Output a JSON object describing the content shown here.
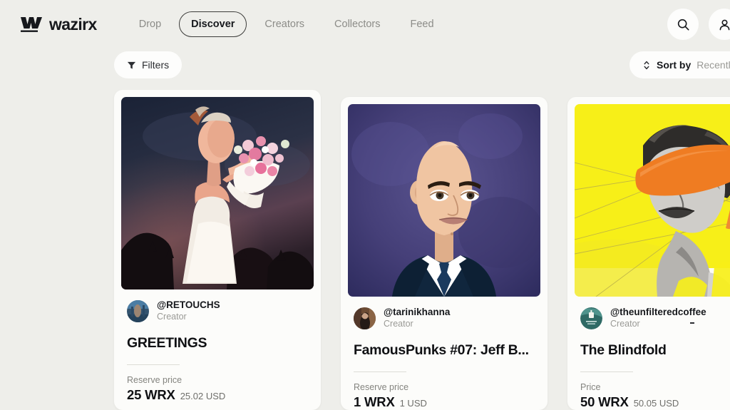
{
  "header": {
    "brand": "wazirx",
    "brand_icon": "wazirx-logo-mark",
    "nav": [
      {
        "label": "Drop",
        "active": false
      },
      {
        "label": "Discover",
        "active": true
      },
      {
        "label": "Creators",
        "active": false
      },
      {
        "label": "Collectors",
        "active": false
      },
      {
        "label": "Feed",
        "active": false
      }
    ],
    "search_icon": "search-icon",
    "secondary_icon": "account-icon"
  },
  "toolbar": {
    "filters_label": "Filters",
    "filters_icon": "funnel-icon",
    "sort_icon": "sort-updown-icon",
    "sort_label": "Sort by",
    "sort_value": "Recently A"
  },
  "colors": {
    "page_background": "#eeeeea",
    "card_background": "#fcfcfa",
    "text_primary": "#101114",
    "text_muted": "#9a9a96",
    "accent_yellow": "#f6ec1c",
    "accent_orange": "#ef7c22"
  },
  "cards": [
    {
      "artwork_name": "greetings-artwork",
      "creator_handle": "@RETOUCHS",
      "creator_role": "Creator",
      "title": "GREETINGS",
      "price_label": "Reserve price",
      "price_main": "25 WRX",
      "price_usd": "25.02 USD"
    },
    {
      "artwork_name": "famouspunks-jeff-artwork",
      "creator_handle": "@tarinikhanna",
      "creator_role": "Creator",
      "title": "FamousPunks #07: Jeff B...",
      "price_label": "Reserve price",
      "price_main": "1 WRX",
      "price_usd": "1 USD"
    },
    {
      "artwork_name": "the-blindfold-artwork",
      "creator_handle": "@theunfilteredcoffee",
      "creator_role": "Creator",
      "title": "The Blindfold",
      "price_label": "Price",
      "price_main": "50 WRX",
      "price_usd": "50.05 USD"
    }
  ]
}
